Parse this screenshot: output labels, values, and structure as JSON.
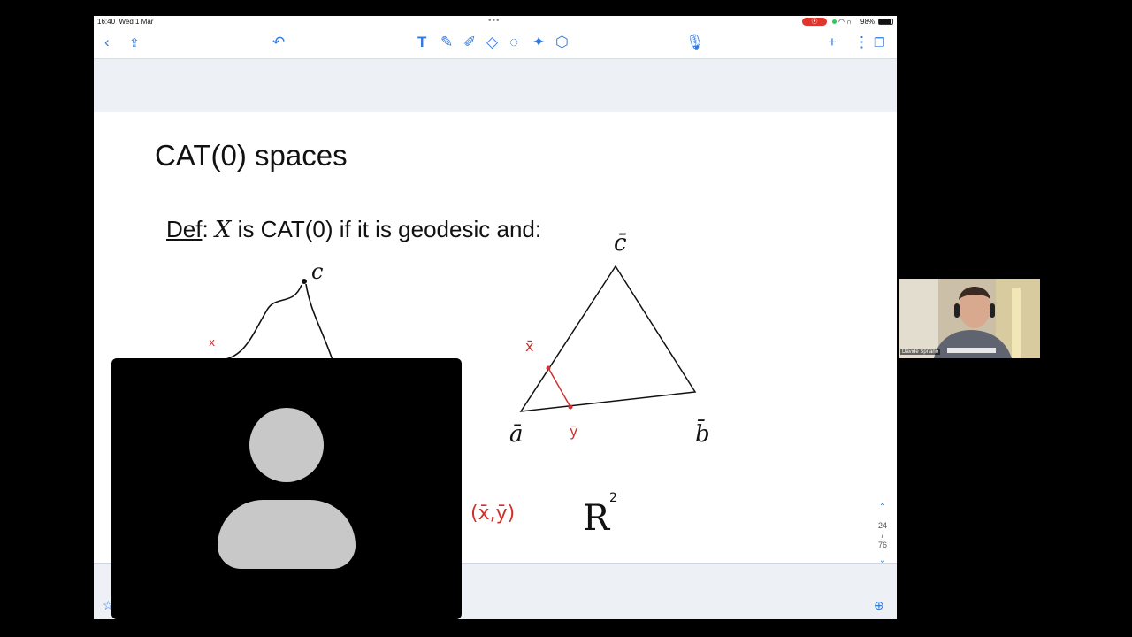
{
  "status_bar": {
    "time": "16:40",
    "date": "Wed 1 Mar",
    "battery": "98%"
  },
  "toolbar": {
    "icons": [
      "chevron-left-icon",
      "share-icon",
      "undo-icon",
      "text-tool-icon",
      "pen-icon",
      "highlighter-icon",
      "eraser-icon",
      "lasso-icon",
      "magic-icon",
      "shapes-icon",
      "microphone-icon",
      "add-icon",
      "more-icon",
      "pages-icon"
    ]
  },
  "slide": {
    "title": "CAT(0) spaces",
    "def_word": "Def",
    "def_var": "X",
    "def_rest": " is CAT(0) if it is geodesic and:",
    "handwriting": {
      "left_vertex": "c",
      "left_point": "x",
      "right_top": "c̄",
      "right_left": "ā",
      "right_right": "b̄",
      "right_x": "x̄",
      "right_y": "ȳ",
      "pair": "(x̄,ȳ)",
      "space": "R",
      "exponent": "2"
    }
  },
  "page_nav": {
    "current": "24",
    "total": "76"
  },
  "webcam": {
    "name": "Davide Spriano"
  },
  "colors": {
    "accent": "#2f7ae5",
    "ink_red": "#d0312d",
    "ink_black": "#111111"
  }
}
